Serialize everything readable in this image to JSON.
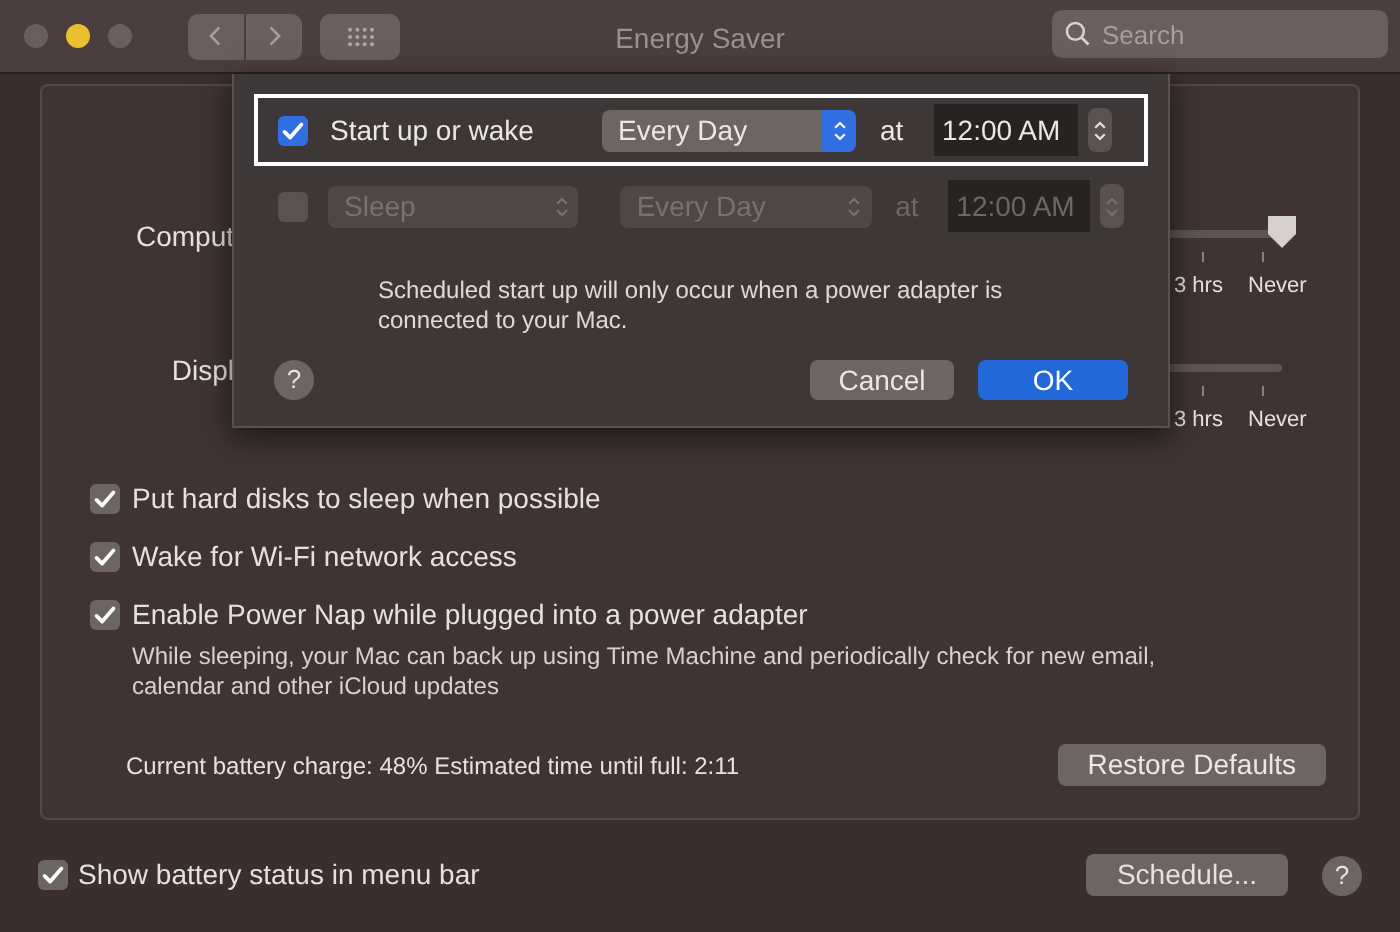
{
  "window": {
    "title": "Energy Saver",
    "search": {
      "placeholder": "Search"
    }
  },
  "panel": {
    "sliders": [
      {
        "label": "Comput",
        "level": 1,
        "ticks": [
          "3 hrs",
          "Never"
        ]
      },
      {
        "label": "Displ",
        "ticks": [
          "3 hrs",
          "Never"
        ]
      }
    ],
    "options": [
      {
        "label": "Put hard disks to sleep when possible",
        "checked": true
      },
      {
        "label": "Wake for Wi-Fi network access",
        "checked": true
      },
      {
        "label": "Enable Power Nap while plugged into a power adapter",
        "checked": true,
        "description": "While sleeping, your Mac can back up using Time Machine and periodically check for new email, calendar and other iCloud updates"
      }
    ],
    "battery_status": "Current battery charge: 48% Estimated time until full: 2:11",
    "restore_button": "Restore Defaults"
  },
  "footer": {
    "checkbox": {
      "label": "Show battery status in menu bar",
      "checked": true
    },
    "schedule_button": "Schedule...",
    "help": "?"
  },
  "sheet": {
    "rows": [
      {
        "kind": "label",
        "checked": true,
        "selected": true,
        "enabled": true,
        "event": "Start up or wake",
        "frequency": "Every Day",
        "at": "at",
        "time": "12:00 AM"
      },
      {
        "kind": "popup",
        "checked": false,
        "selected": false,
        "enabled": false,
        "event": "Sleep",
        "frequency": "Every Day",
        "at": "at",
        "time": "12:00 AM"
      }
    ],
    "note": "Scheduled start up will only occur when a power adapter is connected to your Mac.",
    "help": "?",
    "cancel_button": "Cancel",
    "ok_button": "OK"
  }
}
